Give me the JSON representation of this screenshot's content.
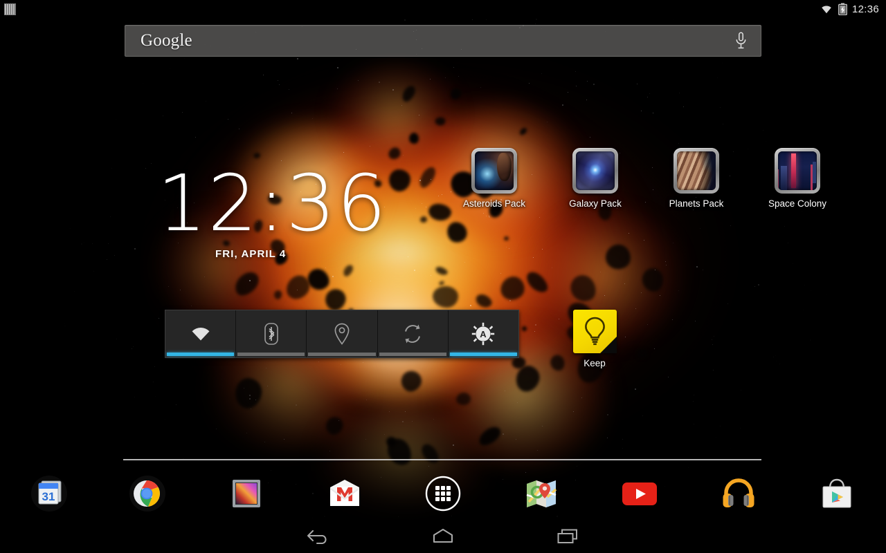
{
  "status_bar": {
    "notification_icon": "notification-bars-icon",
    "wifi_icon": "wifi-icon",
    "battery_icon": "battery-charging-icon",
    "time": "12:36"
  },
  "search": {
    "brand": "Google",
    "mic_icon": "microphone-icon",
    "placeholder": "Google"
  },
  "clock_widget": {
    "time": "12:36",
    "date": "FRI, APRIL 4"
  },
  "shortcuts": [
    {
      "label": "Asteroids Pack",
      "icon": "asteroids-pack-icon"
    },
    {
      "label": "Galaxy Pack",
      "icon": "galaxy-pack-icon"
    },
    {
      "label": "Planets Pack",
      "icon": "planets-pack-icon"
    },
    {
      "label": "Space Colony",
      "icon": "space-colony-icon"
    }
  ],
  "power_widget": {
    "toggles": [
      {
        "name": "wifi",
        "icon": "wifi-icon",
        "state": "on"
      },
      {
        "name": "bluetooth",
        "icon": "bluetooth-icon",
        "state": "off"
      },
      {
        "name": "location",
        "icon": "location-pin-icon",
        "state": "off"
      },
      {
        "name": "sync",
        "icon": "sync-icon",
        "state": "off"
      },
      {
        "name": "brightness",
        "icon": "brightness-auto-icon",
        "state": "on"
      }
    ]
  },
  "keep_widget": {
    "label": "Keep",
    "icon": "keep-lightbulb-icon"
  },
  "dock": {
    "items": [
      {
        "name": "calendar",
        "icon": "calendar-icon",
        "day": "31"
      },
      {
        "name": "chrome",
        "icon": "chrome-icon"
      },
      {
        "name": "gallery",
        "icon": "gallery-icon"
      },
      {
        "name": "gmail",
        "icon": "gmail-icon"
      },
      {
        "name": "app-drawer",
        "icon": "app-drawer-icon"
      },
      {
        "name": "maps",
        "icon": "maps-icon"
      },
      {
        "name": "youtube",
        "icon": "youtube-icon"
      },
      {
        "name": "play-music",
        "icon": "play-music-icon"
      },
      {
        "name": "play-store",
        "icon": "play-store-icon"
      }
    ]
  },
  "nav_bar": {
    "back_icon": "back-arrow-icon",
    "home_icon": "home-icon",
    "recents_icon": "recent-apps-icon"
  },
  "colors": {
    "accent_blue": "#33b5e5",
    "status_text": "#e9e9e9",
    "keep_yellow": "#fbe600",
    "nav_background": "#000000",
    "widget_background": "#262626"
  }
}
